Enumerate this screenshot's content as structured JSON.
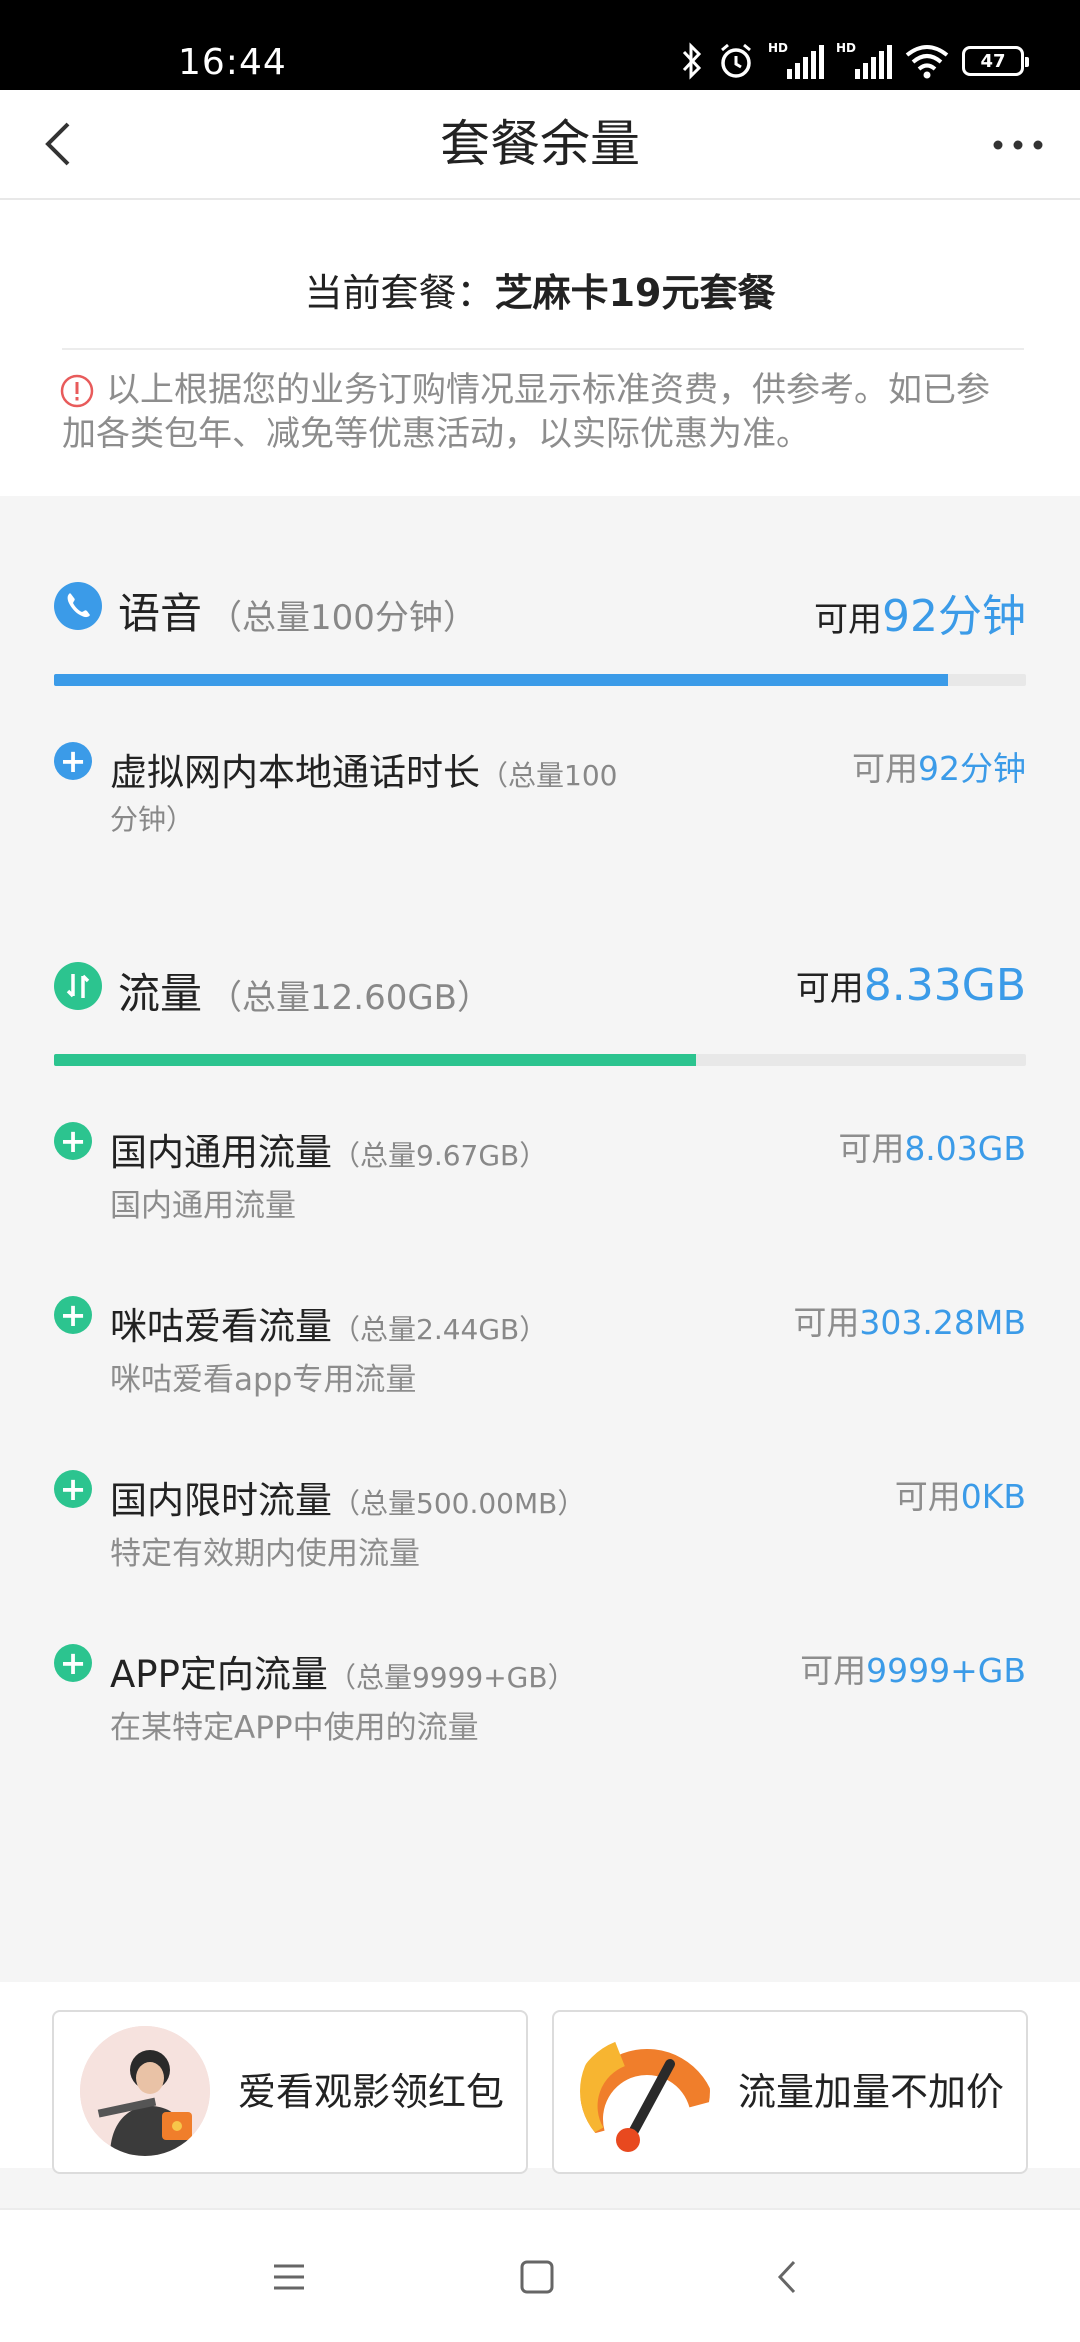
{
  "status_bar": {
    "time": "16:44",
    "battery": "47",
    "network_label": "HD"
  },
  "nav": {
    "title": "套餐余量"
  },
  "package": {
    "label": "当前套餐：",
    "name": "芝麻卡19元套餐",
    "notice": "以上根据您的业务订购情况显示标准资费，供参考。如已参加各类包年、减免等优惠活动，以实际优惠为准。"
  },
  "voice": {
    "title": "语音",
    "total": "（总量100分钟）",
    "avail_label": "可用",
    "avail_value": "92分钟",
    "used_fraction": 0.92,
    "color": "#3b9be8",
    "items": [
      {
        "name": "虚拟网内本地通话时长",
        "total": "（总量100",
        "total2": "分钟）",
        "avail_label": "可用",
        "avail_value": "92分钟"
      }
    ]
  },
  "data": {
    "title": "流量",
    "total": "（总量12.60GB）",
    "avail_label": "可用",
    "avail_value": "8.33GB",
    "used_fraction": 0.661,
    "color": "#2cc48f",
    "items": [
      {
        "name": "国内通用流量",
        "total": "（总量9.67GB）",
        "desc": "国内通用流量",
        "avail_label": "可用",
        "avail_value": "8.03GB"
      },
      {
        "name": "咪咕爱看流量",
        "total": "（总量2.44GB）",
        "desc": "咪咕爱看app专用流量",
        "avail_label": "可用",
        "avail_value": "303.28MB"
      },
      {
        "name": "国内限时流量",
        "total": "（总量500.00MB）",
        "desc": "特定有效期内使用流量",
        "avail_label": "可用",
        "avail_value": "0KB"
      },
      {
        "name": "APP定向流量",
        "total": "（总量9999+GB）",
        "desc": "在某特定APP中使用的流量",
        "avail_label": "可用",
        "avail_value": "9999+GB"
      }
    ]
  },
  "promos": [
    {
      "label": "爱看观影领红包"
    },
    {
      "label": "流量加量不加价"
    }
  ],
  "colors": {
    "accent_blue": "#3b9be8",
    "accent_green": "#2cc48f",
    "warning_red": "#e85b5b"
  }
}
